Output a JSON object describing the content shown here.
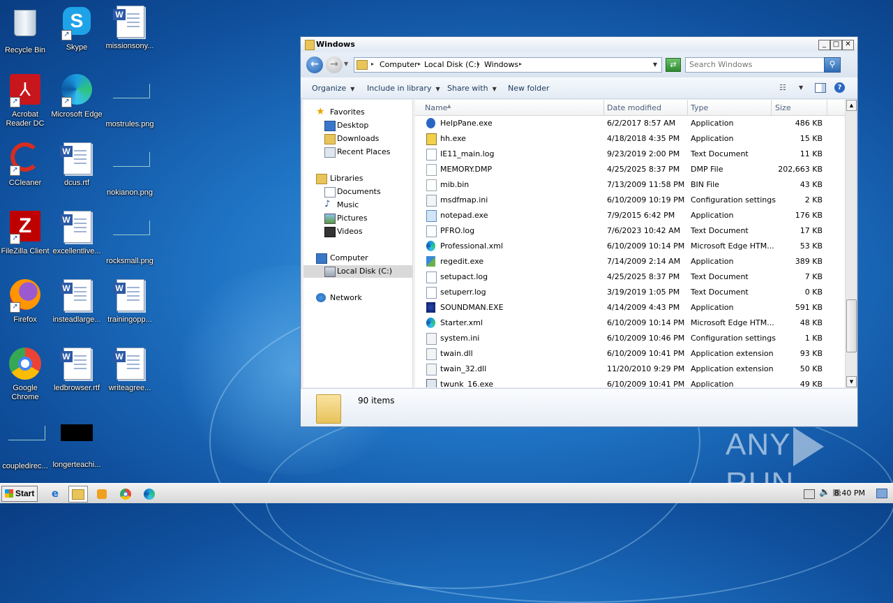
{
  "desktop": {
    "icons": [
      {
        "label": "Recycle Bin"
      },
      {
        "label": "Skype"
      },
      {
        "label": "missionsony..."
      },
      {
        "label": "Acrobat Reader DC"
      },
      {
        "label": "Microsoft Edge"
      },
      {
        "label": "mostrules.png"
      },
      {
        "label": "CCleaner"
      },
      {
        "label": "dcus.rtf"
      },
      {
        "label": "nokianon.png"
      },
      {
        "label": "FileZilla Client"
      },
      {
        "label": "excellentlive..."
      },
      {
        "label": "rocksmall.png"
      },
      {
        "label": "Firefox"
      },
      {
        "label": "insteadlarge..."
      },
      {
        "label": "trainingopp..."
      },
      {
        "label": "Google Chrome"
      },
      {
        "label": "ledbrowser.rtf"
      },
      {
        "label": "writeagree..."
      },
      {
        "label": "coupledirec..."
      },
      {
        "label": "longerteachi..."
      }
    ],
    "watermark": "ANY RUN"
  },
  "window": {
    "title": "Windows",
    "address": {
      "crumbs": [
        "Computer",
        "Local Disk (C:)",
        "Windows"
      ]
    },
    "search": {
      "placeholder": "Search Windows"
    },
    "toolbar": {
      "organize": "Organize",
      "include": "Include in library",
      "share": "Share with",
      "new_folder": "New folder"
    },
    "nav": {
      "favorites": "Favorites",
      "desktop": "Desktop",
      "downloads": "Downloads",
      "recent": "Recent Places",
      "libraries": "Libraries",
      "documents": "Documents",
      "music": "Music",
      "pictures": "Pictures",
      "videos": "Videos",
      "computer": "Computer",
      "localdisk": "Local Disk (C:)",
      "network": "Network"
    },
    "columns": {
      "name": "Name",
      "date": "Date modified",
      "type": "Type",
      "size": "Size"
    },
    "files": [
      {
        "name": "HelpPane.exe",
        "date": "6/2/2017 8:57 AM",
        "type": "Application",
        "size": "486 KB",
        "icon": "help-icon"
      },
      {
        "name": "hh.exe",
        "date": "4/18/2018 4:35 PM",
        "type": "Application",
        "size": "15 KB",
        "icon": "help-doc-icon"
      },
      {
        "name": "IE11_main.log",
        "date": "9/23/2019 2:00 PM",
        "type": "Text Document",
        "size": "11 KB",
        "icon": "text-file-icon"
      },
      {
        "name": "MEMORY.DMP",
        "date": "4/25/2025 8:37 PM",
        "type": "DMP File",
        "size": "202,663 KB",
        "icon": "file-icon"
      },
      {
        "name": "mib.bin",
        "date": "7/13/2009 11:58 PM",
        "type": "BIN File",
        "size": "43 KB",
        "icon": "file-icon"
      },
      {
        "name": "msdfmap.ini",
        "date": "6/10/2009 10:19 PM",
        "type": "Configuration settings",
        "size": "2 KB",
        "icon": "settings-file-icon"
      },
      {
        "name": "notepad.exe",
        "date": "7/9/2015 6:42 PM",
        "type": "Application",
        "size": "176 KB",
        "icon": "notepad-icon"
      },
      {
        "name": "PFRO.log",
        "date": "7/6/2023 10:42 AM",
        "type": "Text Document",
        "size": "17 KB",
        "icon": "text-file-icon"
      },
      {
        "name": "Professional.xml",
        "date": "6/10/2009 10:14 PM",
        "type": "Microsoft Edge HTM...",
        "size": "53 KB",
        "icon": "edge-icon"
      },
      {
        "name": "regedit.exe",
        "date": "7/14/2009 2:14 AM",
        "type": "Application",
        "size": "389 KB",
        "icon": "regedit-icon"
      },
      {
        "name": "setupact.log",
        "date": "4/25/2025 8:37 PM",
        "type": "Text Document",
        "size": "7 KB",
        "icon": "text-file-icon"
      },
      {
        "name": "setuperr.log",
        "date": "3/19/2019 1:05 PM",
        "type": "Text Document",
        "size": "0 KB",
        "icon": "text-file-icon"
      },
      {
        "name": "SOUNDMAN.EXE",
        "date": "4/14/2009 4:43 PM",
        "type": "Application",
        "size": "591 KB",
        "icon": "soundman-icon"
      },
      {
        "name": "Starter.xml",
        "date": "6/10/2009 10:14 PM",
        "type": "Microsoft Edge HTM...",
        "size": "48 KB",
        "icon": "edge-icon"
      },
      {
        "name": "system.ini",
        "date": "6/10/2009 10:46 PM",
        "type": "Configuration settings",
        "size": "1 KB",
        "icon": "settings-file-icon"
      },
      {
        "name": "twain.dll",
        "date": "6/10/2009 10:41 PM",
        "type": "Application extension",
        "size": "93 KB",
        "icon": "dll-icon"
      },
      {
        "name": "twain_32.dll",
        "date": "11/20/2010 9:29 PM",
        "type": "Application extension",
        "size": "50 KB",
        "icon": "dll-icon"
      },
      {
        "name": "twunk_16.exe",
        "date": "6/10/2009 10:41 PM",
        "type": "Application",
        "size": "49 KB",
        "icon": "app-icon"
      }
    ],
    "status": {
      "count": "90 items"
    }
  },
  "taskbar": {
    "start": "Start",
    "clock": "8:40 PM"
  }
}
